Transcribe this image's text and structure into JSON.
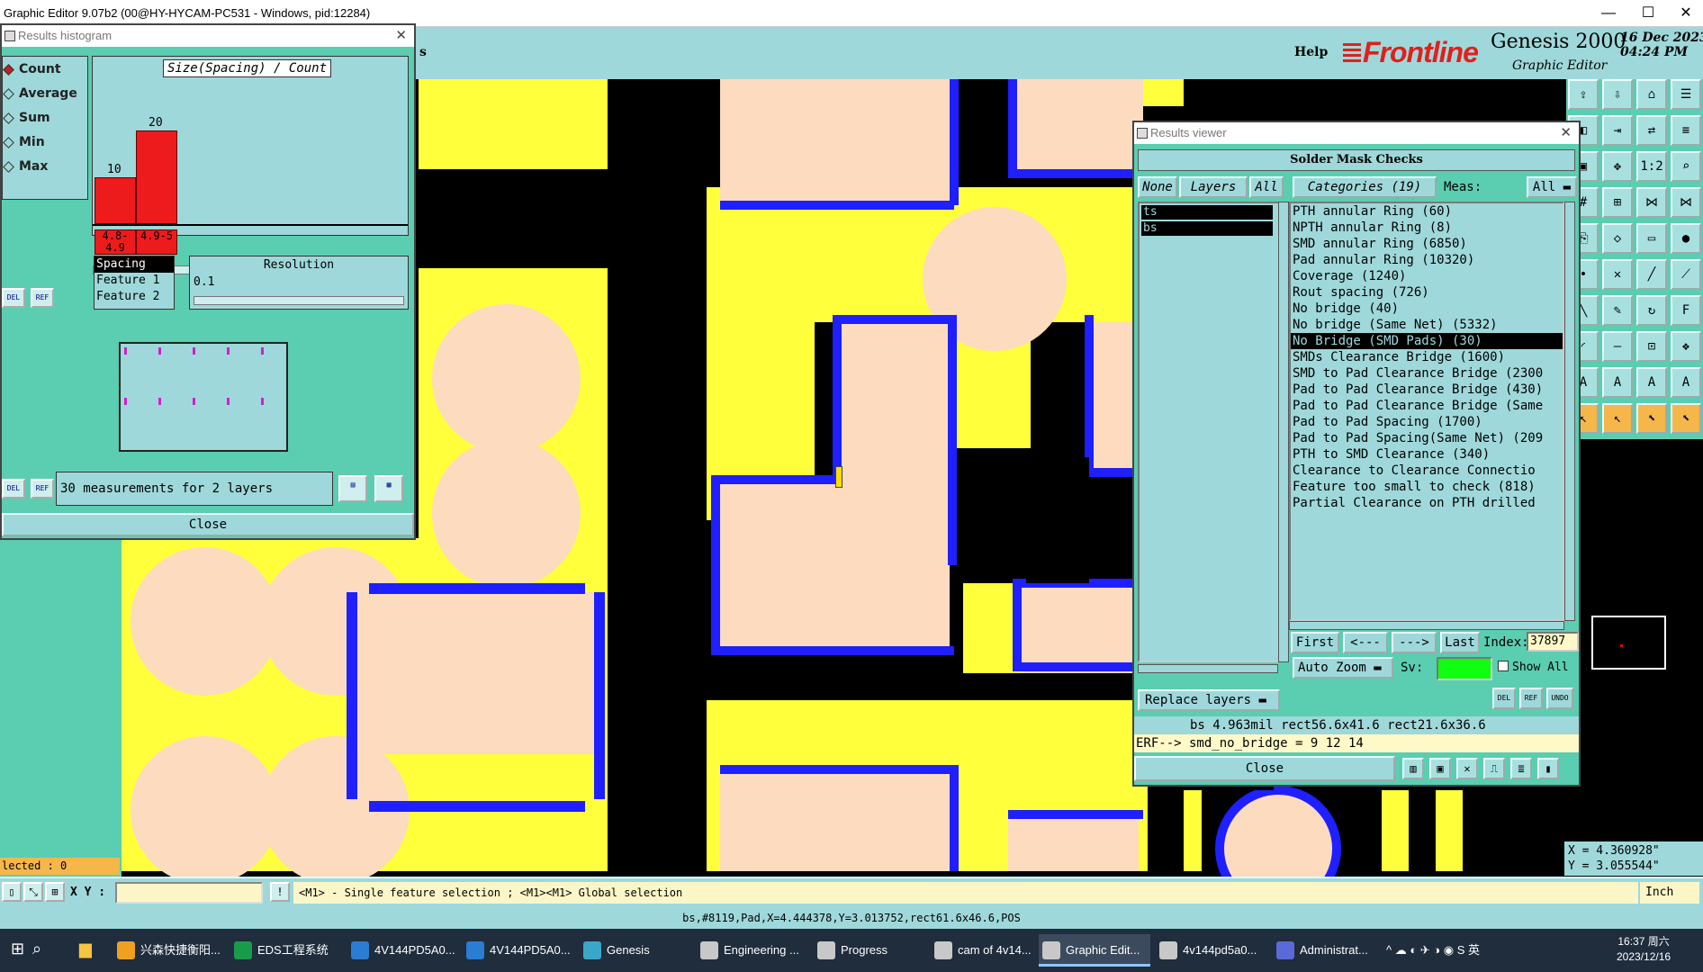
{
  "titlebar": {
    "title": "Graphic Editor 9.07b2 (00@HY-HYCAM-PC531 - Windows, pid:12284)",
    "minimize": "—",
    "maximize": "☐",
    "close": "✕"
  },
  "header": {
    "partial_menu": "s",
    "help": "Help",
    "logo": "Frontline",
    "product": "Genesis 2000",
    "product_sub": "Graphic Editor",
    "date": "16 Dec 2023\n04:24 PM"
  },
  "histogram": {
    "window_title": "Results histogram",
    "options": [
      {
        "label": "Count",
        "selected": true
      },
      {
        "label": "Average",
        "selected": false
      },
      {
        "label": "Sum",
        "selected": false
      },
      {
        "label": "Min",
        "selected": false
      },
      {
        "label": "Max",
        "selected": false
      }
    ],
    "plot_title": "Size(Spacing) / Count",
    "bars": [
      {
        "count": "10",
        "bin": "4.8-4.9",
        "value": 10
      },
      {
        "count": "20",
        "bin": "4.9-5",
        "value": 20
      }
    ],
    "del_label": "DEL",
    "ref_label": "REF",
    "measure_list": [
      "Spacing",
      "Feature 1",
      "Feature 2"
    ],
    "resolution_label": "Resolution",
    "resolution_value": "0.1",
    "measurements_text": "30 measurements for 2 layers",
    "close_label": "Close"
  },
  "chart_data": {
    "type": "bar",
    "title": "Size(Spacing) / Count",
    "categories": [
      "4.8-4.9",
      "4.9-5"
    ],
    "values": [
      10,
      20
    ],
    "xlabel": "",
    "ylabel": ""
  },
  "results_viewer": {
    "window_title": "Results viewer",
    "header": "Solder Mask Checks",
    "none_label": "None",
    "layers_label": "Layers",
    "all_label": "All",
    "categories_label": "Categories (19)",
    "meas_label": "Meas:",
    "meas_value": "All",
    "layers": [
      "ts",
      "bs"
    ],
    "categories": [
      "PTH annular Ring (60)",
      "NPTH annular Ring (8)",
      "SMD annular Ring (6850)",
      "Pad annular Ring (10320)",
      "Coverage (1240)",
      "Rout spacing (726)",
      "No bridge (40)",
      "No bridge (Same Net) (5332)",
      "No Bridge (SMD Pads) (30)",
      "SMDs Clearance Bridge (1600)",
      "SMD to Pad Clearance Bridge (2300",
      "Pad to Pad Clearance Bridge (430)",
      "Pad to Pad Clearance Bridge (Same",
      "Pad to Pad Spacing (1700)",
      "Pad to Pad Spacing(Same Net) (209",
      "PTH to SMD Clearance (340)",
      "Clearance to Clearance Connectio",
      "Feature too small to check (818)",
      "Partial Clearance on PTH drilled"
    ],
    "selected_category": 8,
    "first_label": "First",
    "prev_label": "<---",
    "next_label": "--->",
    "last_label": "Last",
    "index_label": "Index:",
    "index_value": "37897",
    "autozoom_label": "Auto Zoom",
    "sv_label": "Sv:",
    "showall_label": "Show All",
    "replace_label": "Replace layers",
    "del_label": "DEL",
    "ref_label": "REF",
    "undo_label": "UNDO",
    "info": "bs 4.963mil  rect56.6x41.6  rect21.6x36.6",
    "erf": "ERF--> smd_no_bridge = 9 12 14",
    "close_label": "Close"
  },
  "left": {
    "selected": "lected : 0"
  },
  "coords": {
    "x": "X = 4.360928\"",
    "y": "Y = 3.055544\""
  },
  "cmdbar": {
    "xy_label": "X Y :",
    "xy_value": "",
    "message": "<M1> - Single feature selection ; <M1><M1> Global selection",
    "unit": "Inch"
  },
  "status": "bs,#8119,Pad,X=4.444378,Y=3.013752,rect61.6x46.6,POS",
  "taskbar": {
    "items": [
      {
        "label": "兴森快捷衡阳...",
        "color": "#f0a020"
      },
      {
        "label": "EDS工程系统",
        "color": "#1a9b4a"
      },
      {
        "label": "4V144PD5A0...",
        "color": "#2b7cd3"
      },
      {
        "label": "4V144PD5A0...",
        "color": "#2b7cd3"
      },
      {
        "label": "Genesis",
        "color": "#3aa7c8"
      },
      {
        "label": "Engineering ...",
        "color": "#c8c8c8"
      },
      {
        "label": "Progress",
        "color": "#c8c8c8"
      },
      {
        "label": "cam of 4v14...",
        "color": "#c8c8c8"
      },
      {
        "label": "Graphic Edit...",
        "color": "#c8c8c8"
      },
      {
        "label": "4v144pd5a0...",
        "color": "#c8c8c8"
      },
      {
        "label": "Administrat...",
        "color": "#5a6ad8"
      }
    ],
    "active_index": 8,
    "tray": "^ ☁ ◐ ✈ ◑ ◉ S 英",
    "time": "16:37 周六",
    "date": "2023/12/16"
  }
}
